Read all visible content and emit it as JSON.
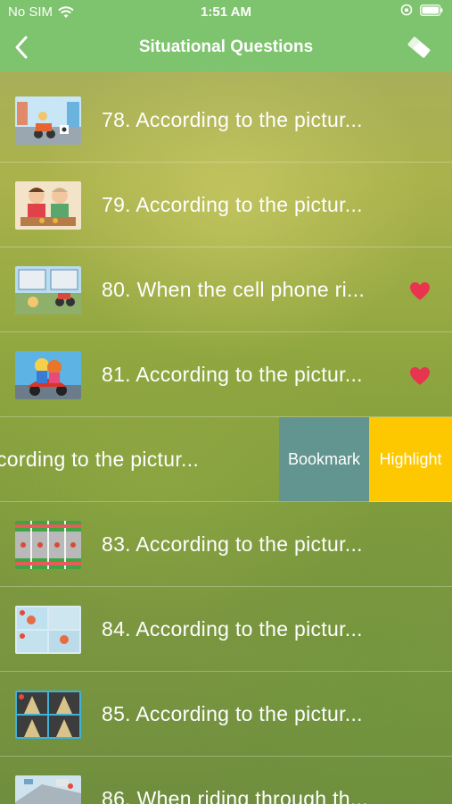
{
  "status_bar": {
    "carrier": "No SIM",
    "time": "1:51 AM"
  },
  "nav": {
    "title": "Situational Questions",
    "back_icon": "chevron-left-icon",
    "right_icon": "eraser-icon"
  },
  "colors": {
    "header": "#7ec36d",
    "bookmark": "#62958f",
    "highlight": "#fdc800",
    "heart": "#e8344e"
  },
  "rows": [
    {
      "label": "78. According to the pictur...",
      "favorited": false
    },
    {
      "label": "79. According to the pictur...",
      "favorited": false
    },
    {
      "label": "80. When the cell phone ri...",
      "favorited": true
    },
    {
      "label": "81. According to the pictur...",
      "favorited": true
    },
    {
      "label": "cording to the pictur...",
      "favorited": false
    },
    {
      "label": "83. According to the pictur...",
      "favorited": false
    },
    {
      "label": "84. According to the pictur...",
      "favorited": false
    },
    {
      "label": "85. According to the pictur...",
      "favorited": false
    },
    {
      "label": "86. When riding through th...",
      "favorited": false
    }
  ],
  "swipe_actions": {
    "bookmark_label": "Bookmark",
    "highlight_label": "Highlight"
  }
}
